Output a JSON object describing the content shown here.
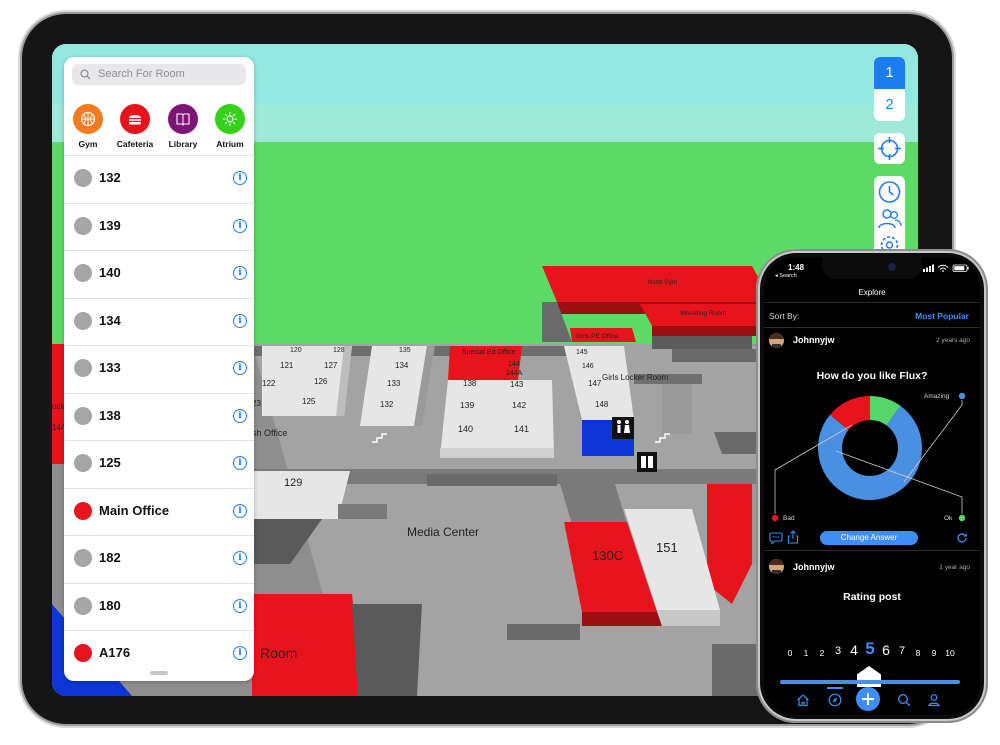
{
  "ipad": {
    "search": {
      "placeholder": "Search For Room"
    },
    "categories": [
      {
        "label": "Gym",
        "icon": "basketball-icon",
        "color": "#f47b20"
      },
      {
        "label": "Cafeteria",
        "icon": "burger-icon",
        "color": "#e8141b"
      },
      {
        "label": "Library",
        "icon": "book-icon",
        "color": "#7e1478"
      },
      {
        "label": "Atrium",
        "icon": "sun-icon",
        "color": "#35d21a"
      }
    ],
    "rooms": [
      {
        "name": "132",
        "color": "#a6a6a6"
      },
      {
        "name": "139",
        "color": "#a6a6a6"
      },
      {
        "name": "140",
        "color": "#a6a6a6"
      },
      {
        "name": "134",
        "color": "#a6a6a6"
      },
      {
        "name": "133",
        "color": "#a6a6a6"
      },
      {
        "name": "138",
        "color": "#a6a6a6"
      },
      {
        "name": "125",
        "color": "#a6a6a6"
      },
      {
        "name": "Main Office",
        "color": "#e8141b"
      },
      {
        "name": "182",
        "color": "#a6a6a6"
      },
      {
        "name": "180",
        "color": "#a6a6a6"
      },
      {
        "name": "A176",
        "color": "#e8141b"
      }
    ],
    "floors": [
      "1",
      "2"
    ],
    "selected_floor": "1",
    "map_labels": {
      "north_gym": "North Gym",
      "wrestling_room": "Wrestling Room",
      "girls_pe_office": "Girls PE Office",
      "special_ed_office": "Special Ed Office",
      "girls_locker_room": "Girls Locker Room",
      "media_center": "Media Center",
      "room_fragment": "Room",
      "office_fragment": "sh Office",
      "locker_fragment": "ocker",
      "r120": "120",
      "r128": "128",
      "r135": "135",
      "r121": "121",
      "r127": "127",
      "r122": "122",
      "r126": "126",
      "r134": "134",
      "r133": "133",
      "r132": "132",
      "r123": "23",
      "r125": "125",
      "r144": "144",
      "r144a": "144A",
      "r138": "138",
      "r143": "143",
      "r139": "139",
      "r142": "142",
      "r140": "140",
      "r141": "141",
      "r145": "145",
      "r146": "146",
      "r147": "147",
      "r148": "148",
      "r129": "129",
      "r130c": "130C",
      "r151": "151",
      "r14a": "14A"
    }
  },
  "iphone": {
    "time": "1:48",
    "back_label": "◂ Search",
    "title": "Explore",
    "sort_label": "Sort By:",
    "sort_value": "Most Popular",
    "posts": [
      {
        "user": "Johnnyjw",
        "time": "2 years ago",
        "question": "How do you like Flux?",
        "chart_labels": {
          "amazing": "Amazing",
          "bad": "Bad",
          "ok": "Ok"
        },
        "button": "Change Answer"
      },
      {
        "user": "Johnnyjw",
        "time": "1 year ago",
        "question": "Rating post",
        "scale": [
          "0",
          "1",
          "2",
          "3",
          "4",
          "5",
          "6",
          "7",
          "8",
          "9",
          "10"
        ],
        "selected": "5"
      }
    ],
    "colors": {
      "accent": "#3d8ef7",
      "bad": "#e8141b",
      "ok": "#55d66b",
      "amazing": "#4a90e2"
    }
  },
  "chart_data": {
    "type": "pie",
    "categories": [
      "Bad",
      "Ok",
      "Amazing"
    ],
    "values": [
      14,
      10,
      76
    ],
    "title": "How do you like Flux?",
    "colors": [
      "#e8141b",
      "#55d66b",
      "#4a90e2"
    ]
  }
}
